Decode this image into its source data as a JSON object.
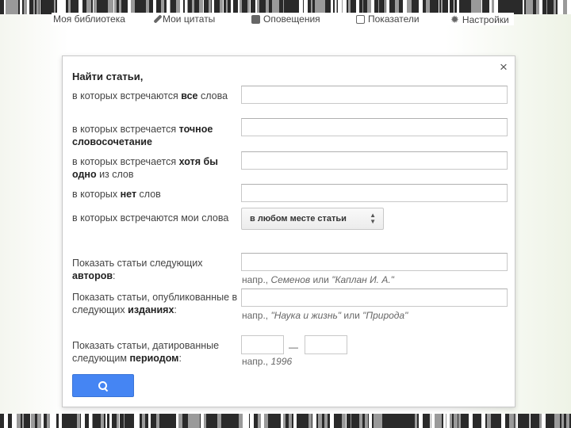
{
  "topnav": {
    "items": [
      {
        "label": "Моя библиотека"
      },
      {
        "label": "Мои цитаты"
      },
      {
        "label": "Оповещения"
      },
      {
        "label": "Показатели"
      },
      {
        "label": "Настройки"
      }
    ]
  },
  "dialog": {
    "close": "×",
    "title": "Найти статьи,",
    "fields": {
      "all_words": {
        "pre": "в которых встречаются ",
        "bold": "все",
        "post": " слова",
        "value": ""
      },
      "exact_phrase": {
        "pre": "в которых встречается ",
        "bold": "точное словосочетание",
        "post": "",
        "value": ""
      },
      "any_words": {
        "pre": "в которых встречается ",
        "bold": "хотя бы одно",
        "post": " из слов",
        "value": ""
      },
      "none_words": {
        "pre": "в которых ",
        "bold": "нет",
        "post": " слов",
        "value": ""
      },
      "where": {
        "label": "в которых встречаются мои слова",
        "selected": "в любом месте статьи"
      },
      "authors": {
        "pre": "Показать статьи следующих ",
        "bold": "авторов",
        "post": ":",
        "value": "",
        "hint_pre": "напр., ",
        "hint_a": "Семенов",
        "hint_mid": " или ",
        "hint_b": "\"Каплан И. А.\""
      },
      "publications": {
        "pre": "Показать статьи, опубликованные в следующих ",
        "bold": "изданиях",
        "post": ":",
        "value": "",
        "hint_pre": "напр., ",
        "hint_a": "\"Наука и жизнь\"",
        "hint_mid": " или ",
        "hint_b": "\"Природа\""
      },
      "dates": {
        "pre": "Показать статьи, датированные следующим ",
        "bold": "периодом",
        "post": ":",
        "from": "",
        "to": "",
        "separator": "—",
        "hint_pre": "напр., ",
        "hint_a": "1996"
      }
    }
  },
  "colors": {
    "button": "#4585f3",
    "border": "#c8c8c8"
  }
}
